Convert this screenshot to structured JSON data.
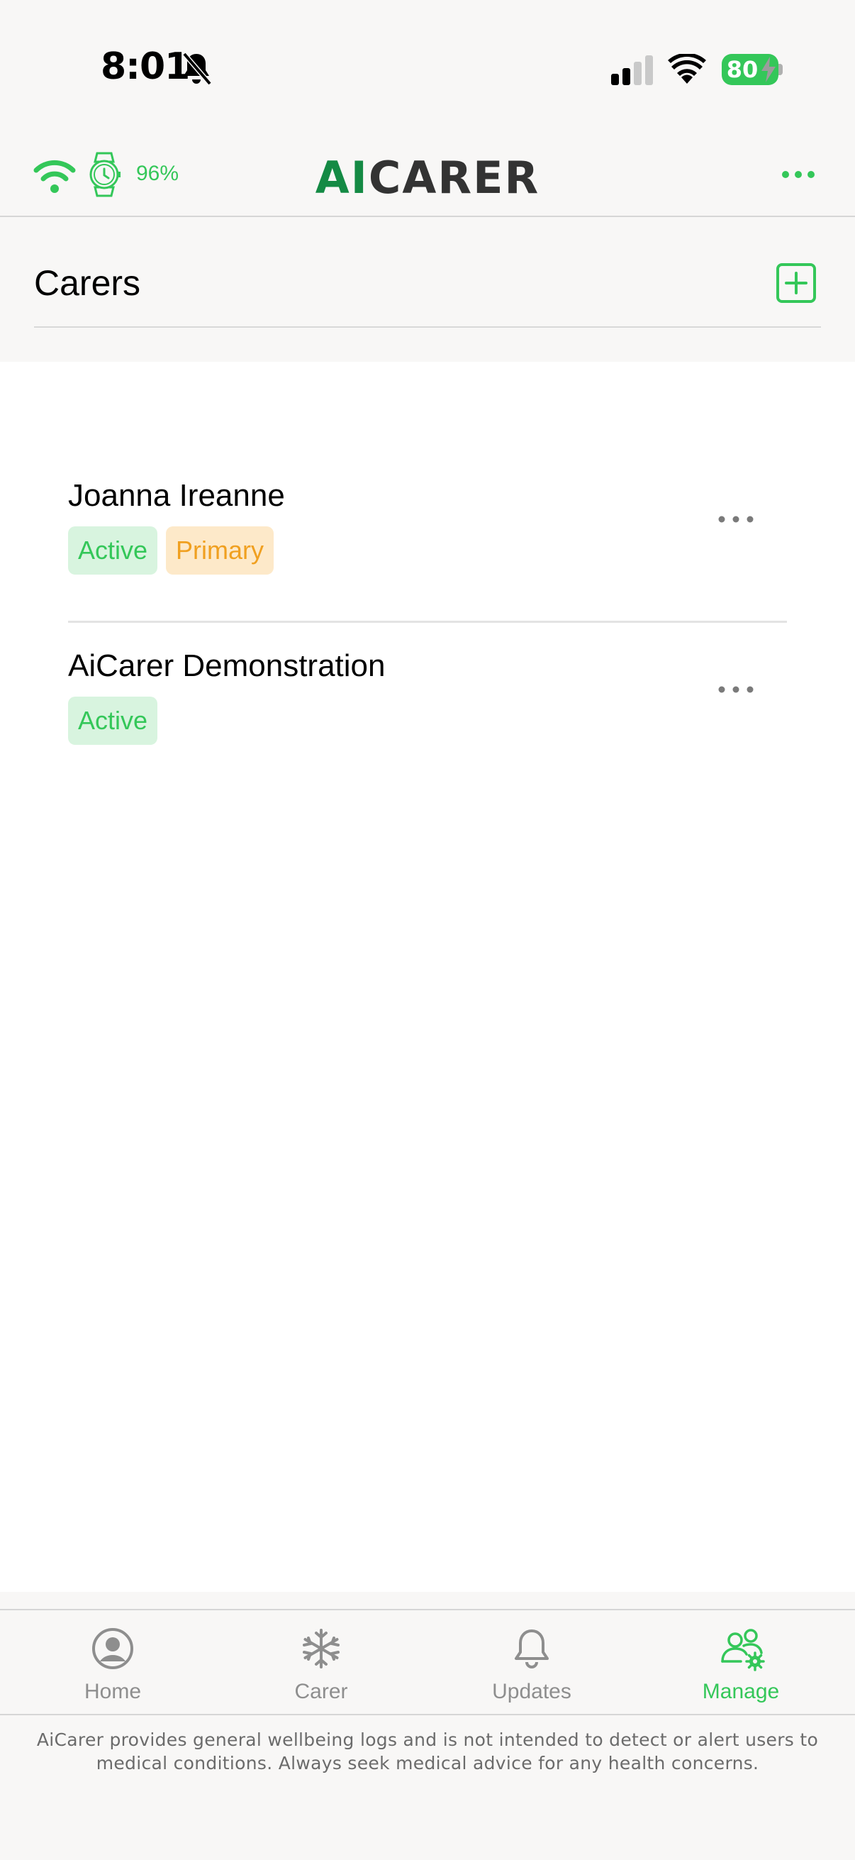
{
  "status_bar": {
    "time": "8:01",
    "battery_level": "80",
    "icons": [
      "bell-slash-icon",
      "cell-signal-icon",
      "wifi-icon",
      "battery-icon"
    ]
  },
  "header": {
    "brand_accent": "AI",
    "brand_rest": "CARER",
    "watch_battery": "96%",
    "icons": [
      "wifi-icon",
      "watch-icon",
      "more-horizontal-icon"
    ],
    "colors": {
      "accent": "#34c759",
      "brand": "#148a44"
    }
  },
  "section": {
    "title": "Carers",
    "add_icon": "plus-square-icon"
  },
  "carers": [
    {
      "name": "Joanna Ireanne",
      "badges": [
        "Active",
        "Primary"
      ]
    },
    {
      "name": "AiCarer Demonstration",
      "badges": [
        "Active"
      ]
    }
  ],
  "tabs": [
    {
      "label": "Home",
      "icon": "person-circle-icon",
      "selected": false
    },
    {
      "label": "Carer",
      "icon": "snowflake-icon",
      "selected": false
    },
    {
      "label": "Updates",
      "icon": "bell-icon",
      "selected": false
    },
    {
      "label": "Manage",
      "icon": "people-settings-icon",
      "selected": true
    }
  ],
  "disclaimer": "AiCarer provides general wellbeing logs and is not intended to detect or alert users to medical conditions. Always seek medical advice for any health concerns."
}
